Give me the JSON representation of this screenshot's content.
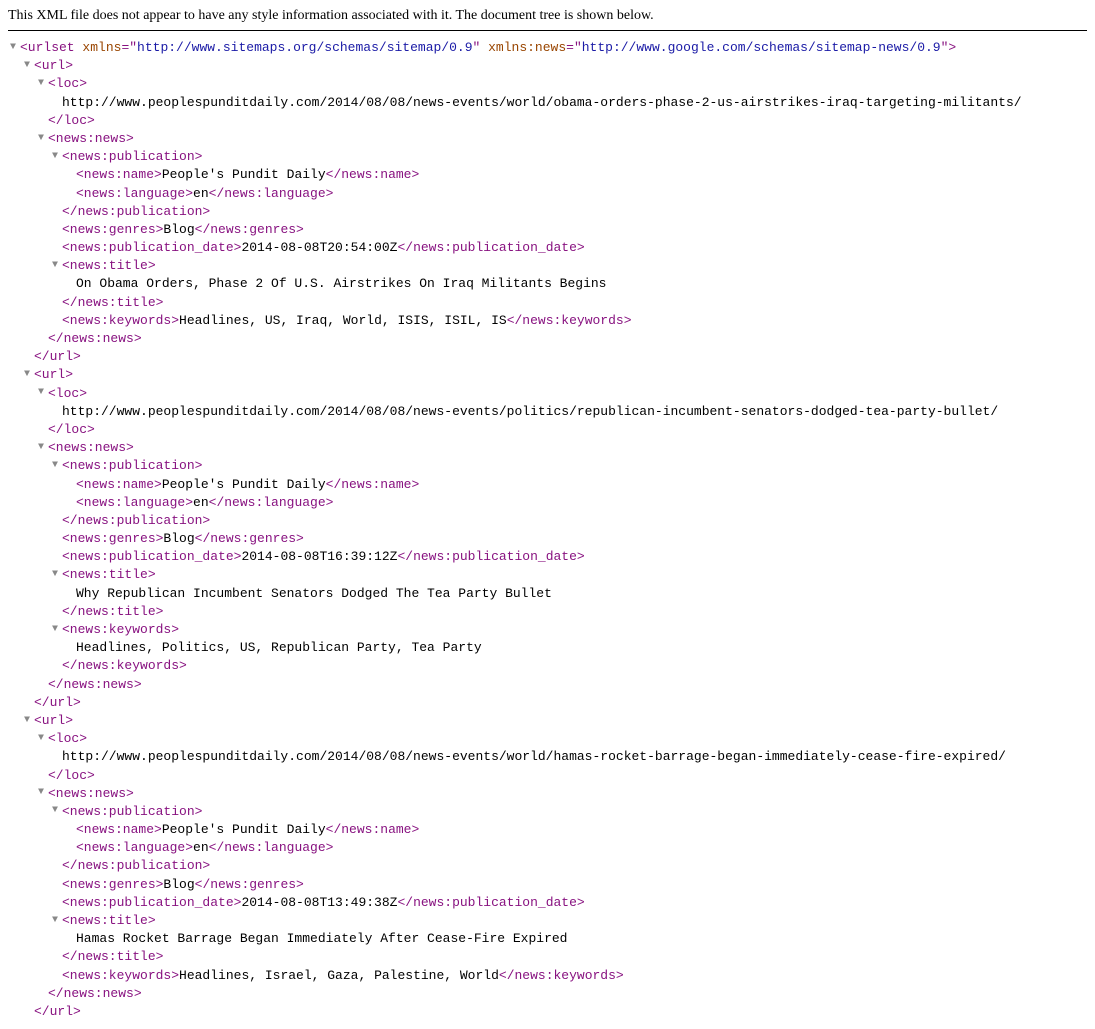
{
  "header": "This XML file does not appear to have any style information associated with it. The document tree is shown below.",
  "root_tag": "urlset",
  "attrs": {
    "xmlns_name": "xmlns",
    "xmlns_val": "http://www.sitemaps.org/schemas/sitemap/0.9",
    "xmlns_news_name": "xmlns:news",
    "xmlns_news_val": "http://www.google.com/schemas/sitemap-news/0.9"
  },
  "tags": {
    "url": "url",
    "loc": "loc",
    "news_news": "news:news",
    "news_publication": "news:publication",
    "news_name": "news:name",
    "news_language": "news:language",
    "news_genres": "news:genres",
    "news_pubdate": "news:publication_date",
    "news_title": "news:title",
    "news_keywords": "news:keywords"
  },
  "common": {
    "publication_name": "People's Pundit Daily",
    "language": "en",
    "genres": "Blog"
  },
  "urls": [
    {
      "loc": "http://www.peoplespunditdaily.com/2014/08/08/news-events/world/obama-orders-phase-2-us-airstrikes-iraq-targeting-militants/",
      "pubdate": "2014-08-08T20:54:00Z",
      "title": "On Obama Orders, Phase 2 Of U.S. Airstrikes On Iraq Militants Begins",
      "keywords": "Headlines, US, Iraq, World, ISIS, ISIL, IS",
      "keywords_inline": true
    },
    {
      "loc": "http://www.peoplespunditdaily.com/2014/08/08/news-events/politics/republican-incumbent-senators-dodged-tea-party-bullet/",
      "pubdate": "2014-08-08T16:39:12Z",
      "title": "Why Republican Incumbent Senators Dodged The Tea Party Bullet",
      "keywords": "Headlines, Politics, US, Republican Party, Tea Party",
      "keywords_inline": false
    },
    {
      "loc": "http://www.peoplespunditdaily.com/2014/08/08/news-events/world/hamas-rocket-barrage-began-immediately-cease-fire-expired/",
      "pubdate": "2014-08-08T13:49:38Z",
      "title": "Hamas Rocket Barrage Began Immediately After Cease-Fire Expired",
      "keywords": "Headlines, Israel, Gaza, Palestine, World",
      "keywords_inline": true
    }
  ]
}
